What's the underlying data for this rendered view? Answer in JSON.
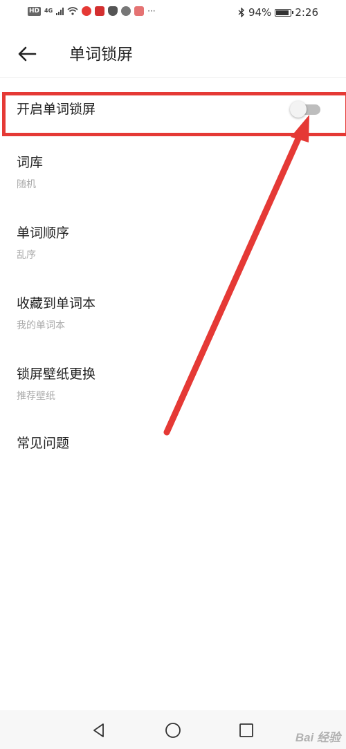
{
  "status_bar": {
    "left_badge": "HD",
    "signal_label": "4G",
    "battery_percent": "94%",
    "battery_level": 0.94,
    "time": "2:26",
    "overflow_dots": "···",
    "app_icon_colors": [
      "#e53935",
      "#d32f2f",
      "#555555",
      "#777777",
      "#e57373"
    ]
  },
  "header": {
    "title": "单词锁屏"
  },
  "settings": {
    "lock_toggle": {
      "label": "开启单词锁屏",
      "enabled": false
    },
    "items": [
      {
        "title": "词库",
        "value": "随机"
      },
      {
        "title": "单词顺序",
        "value": "乱序"
      },
      {
        "title": "收藏到单词本",
        "value": "我的单词本"
      },
      {
        "title": "锁屏壁纸更换",
        "value": "推荐壁纸"
      },
      {
        "title": "常见问题",
        "value": ""
      }
    ]
  },
  "annotation": {
    "color": "#e53935"
  },
  "watermark": {
    "text": "Bai 经验"
  }
}
